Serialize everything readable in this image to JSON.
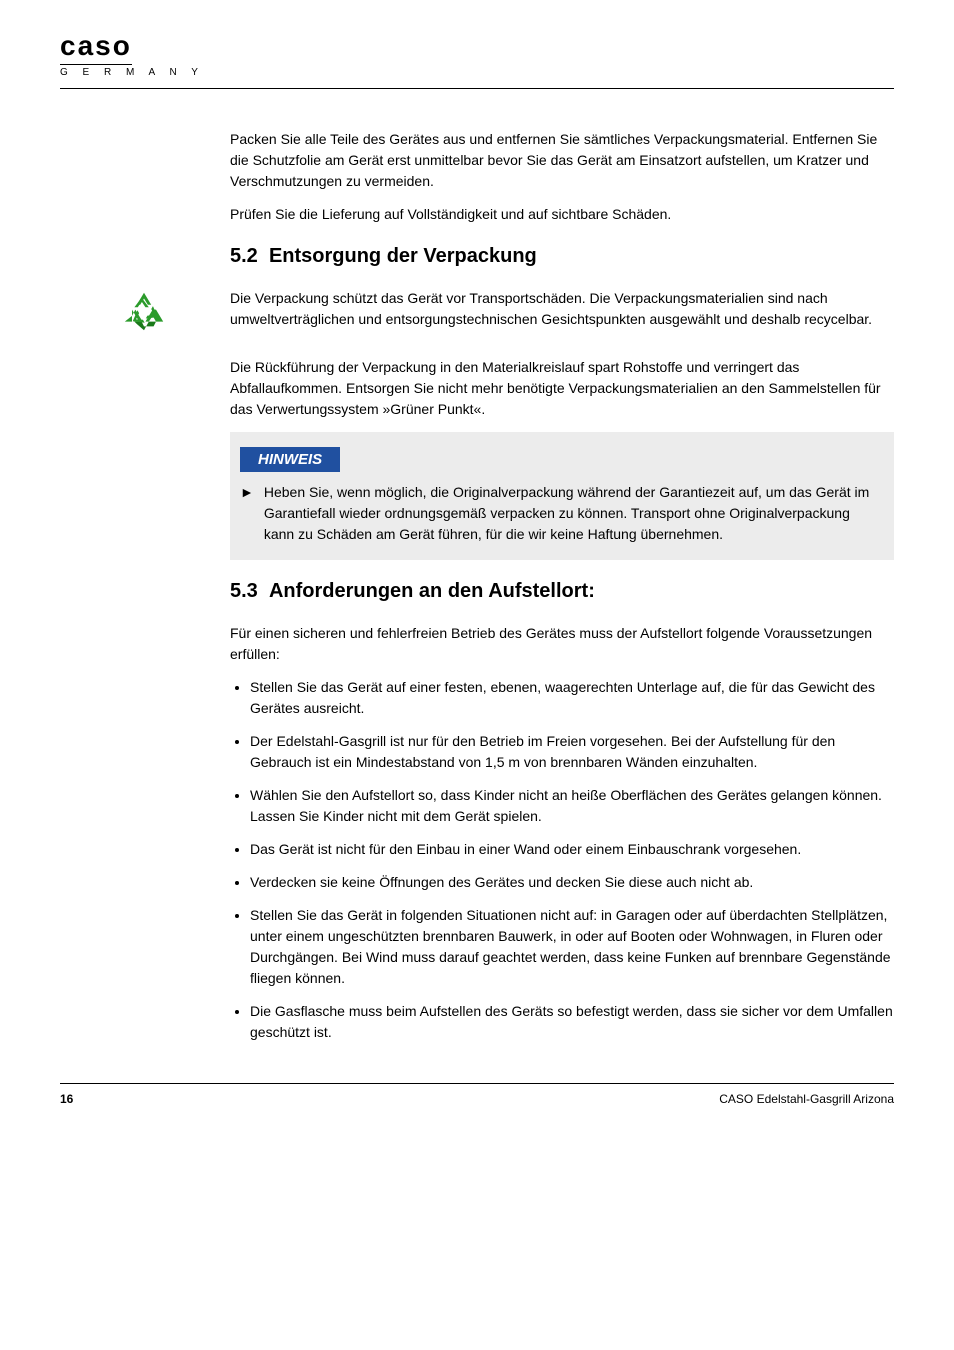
{
  "logo": {
    "main": "caso",
    "sub": "G E R M A N Y"
  },
  "para_intro1": "Packen Sie alle Teile des Gerätes aus und entfernen Sie sämtliches Verpackungsmaterial. Entfernen Sie die Schutzfolie am Gerät erst unmittelbar bevor Sie das Gerät am Einsatzort aufstellen, um Kratzer und Verschmutzungen zu vermeiden.",
  "para_intro2": "Prüfen Sie die Lieferung auf Vollständigkeit und auf sichtbare Schäden.",
  "section1": {
    "number": "5.2",
    "title": "Entsorgung der Verpackung",
    "para1": "Die Verpackung schützt das Gerät vor Transportschäden. Die Verpackungsmaterialien sind nach umweltverträglichen und entsorgungstechnischen Gesichtspunkten ausgewählt und deshalb recycelbar.",
    "para2": "Die Rückführung der Verpackung in den Materialkreislauf spart Rohstoffe und verringert das Abfallaufkommen. Entsorgen Sie nicht mehr benötigte Verpackungsmaterialien an den Sammelstellen für das Verwertungssystem »Grüner Punkt«."
  },
  "note": {
    "header": "HINWEIS",
    "text": "Heben Sie, wenn möglich, die Originalverpackung während der Garantiezeit auf, um das Gerät im Garantiefall wieder ordnungsgemäß verpacken zu können. Transport ohne Originalverpackung kann zu Schäden am Gerät führen, für die wir keine Haftung übernehmen."
  },
  "section2": {
    "number": "5.3",
    "title": "Anforderungen an den Aufstellort:"
  },
  "para_req": "Für einen sicheren und fehlerfreien Betrieb des Gerätes muss der Aufstellort folgende Voraussetzungen erfüllen:",
  "requirements": [
    "Stellen Sie das Gerät auf einer festen, ebenen, waagerechten Unterlage auf, die für das Gewicht des Gerätes ausreicht.",
    "Der Edelstahl-Gasgrill ist nur für den Betrieb im Freien vorgesehen. Bei der Aufstellung für den Gebrauch ist ein Mindestabstand von 1,5 m von brennbaren Wänden einzuhalten.",
    "Wählen Sie den Aufstellort so, dass Kinder nicht an heiße Oberflächen des Gerätes gelangen können. Lassen Sie Kinder nicht mit dem Gerät spielen.",
    "Das Gerät ist nicht für den Einbau in einer Wand oder einem Einbauschrank vorgesehen.",
    "Verdecken sie keine Öffnungen des Gerätes und decken Sie diese auch nicht ab.",
    "Stellen Sie das Gerät in folgenden Situationen nicht auf: in Garagen oder auf überdachten Stellplätzen, unter einem ungeschützten brennbaren Bauwerk, in oder auf Booten oder Wohnwagen, in Fluren oder Durchgängen. Bei Wind muss darauf geachtet werden, dass keine Funken auf brennbare Gegenstände fliegen können.",
    "Die Gasflasche muss beim Aufstellen des Geräts so befestigt werden, dass sie sicher vor dem Umfallen geschützt ist."
  ],
  "footer": {
    "page": "16",
    "product": "CASO Edelstahl-Gasgrill Arizona"
  }
}
